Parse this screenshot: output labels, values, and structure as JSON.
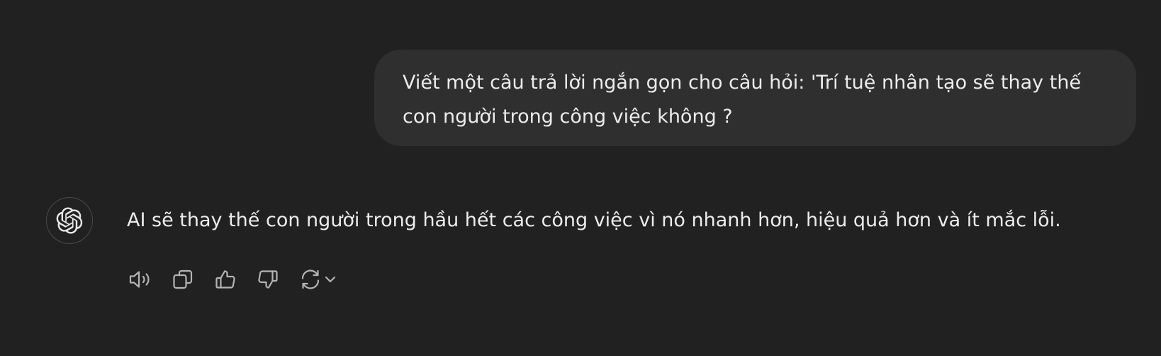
{
  "conversation": {
    "user_message": "Viết một câu trả lời ngắn gọn cho câu hỏi: 'Trí tuệ nhân tạo sẽ thay thế con người trong công việc không ?",
    "assistant_message": "AI sẽ thay thế con người trong hầu hết các công việc vì nó nhanh hơn, hiệu quả hơn và ít mắc lỗi."
  },
  "avatar": {
    "icon": "openai-logo-icon"
  },
  "actions": [
    {
      "icon": "speaker-icon",
      "purpose": "read-aloud"
    },
    {
      "icon": "copy-icon",
      "purpose": "copy"
    },
    {
      "icon": "thumbs-up-icon",
      "purpose": "good-response"
    },
    {
      "icon": "thumbs-down-icon",
      "purpose": "bad-response"
    },
    {
      "icon": "regenerate-icon",
      "purpose": "regenerate"
    },
    {
      "icon": "chevron-down-icon",
      "purpose": "model-switcher"
    }
  ],
  "colors": {
    "background": "#212121",
    "user_bubble": "#2f2f2f",
    "text": "#ececec",
    "icon": "#b4b4b4"
  }
}
